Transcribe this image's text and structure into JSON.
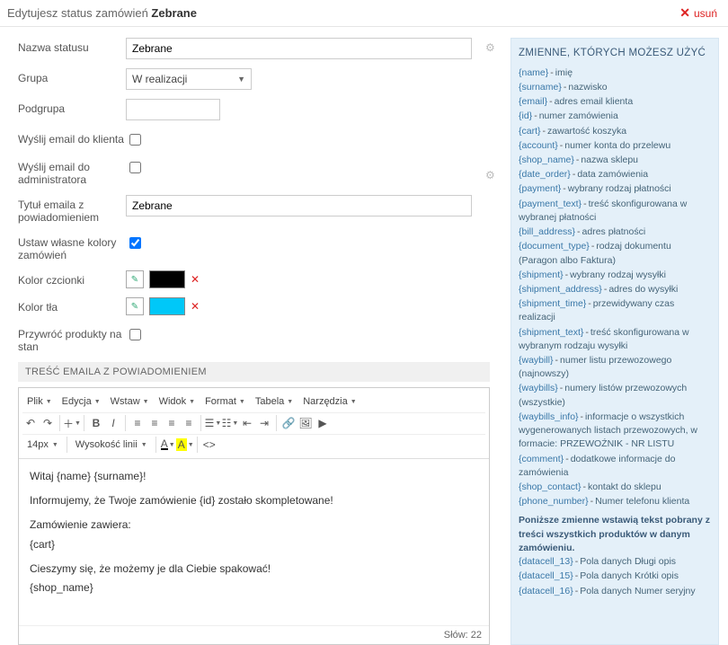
{
  "header": {
    "prefix": "Edytujesz status zamówień ",
    "name": "Zebrane",
    "delete": "usuń"
  },
  "form": {
    "name_label": "Nazwa statusu",
    "name_value": "Zebrane",
    "group_label": "Grupa",
    "group_value": "W realizacji",
    "subgroup_label": "Podgrupa",
    "email_client_label": "Wyślij email do klienta",
    "email_admin_label": "Wyślij email do administratora",
    "email_title_label": "Tytuł emaila z powiadomieniem",
    "email_title_value": "Zebrane",
    "custom_colors_label": "Ustaw własne kolory zamówień",
    "font_color_label": "Kolor czcionki",
    "font_color": "#000000",
    "bg_color_label": "Kolor tła",
    "bg_color": "#00c8f8",
    "restore_label": "Przywróć produkty na stan"
  },
  "section_title": "TREŚĆ EMAILA Z POWIADOMIENIEM",
  "toolbar": {
    "file": "Plik",
    "edit": "Edycja",
    "insert": "Wstaw",
    "view": "Widok",
    "format": "Format",
    "table": "Tabela",
    "tools": "Narzędzia",
    "fontsize": "14px",
    "lineheight": "Wysokość linii"
  },
  "editor": {
    "l1": "Witaj {name} {surname}!",
    "l2": "Informujemy, że Twoje zamówienie {id} zostało skompletowane!",
    "l3": "Zamówienie zawiera:",
    "l4": "{cart}",
    "l5": "Cieszymy się, że możemy je dla Ciebie spakować!",
    "l6": "{shop_name}",
    "words": "Słów: 22"
  },
  "vars": {
    "title": "ZMIENNE, KTÓRYCH MOŻESZ UŻYĆ",
    "items": [
      {
        "k": "{name}",
        "d": "imię"
      },
      {
        "k": "{surname}",
        "d": "nazwisko"
      },
      {
        "k": "{email}",
        "d": "adres email klienta"
      },
      {
        "k": "{id}",
        "d": "numer zamówienia"
      },
      {
        "k": "{cart}",
        "d": "zawartość koszyka"
      },
      {
        "k": "{account}",
        "d": "numer konta do przelewu"
      },
      {
        "k": "{shop_name}",
        "d": "nazwa sklepu"
      },
      {
        "k": "{date_order}",
        "d": "data zamówienia"
      },
      {
        "k": "{payment}",
        "d": "wybrany rodzaj płatności"
      },
      {
        "k": "{payment_text}",
        "d": "treść skonfigurowana w wybranej płatności"
      },
      {
        "k": "{bill_address}",
        "d": "adres płatności"
      },
      {
        "k": "{document_type}",
        "d": "rodzaj dokumentu (Paragon albo Faktura)"
      },
      {
        "k": "{shipment}",
        "d": "wybrany rodzaj wysyłki"
      },
      {
        "k": "{shipment_address}",
        "d": "adres do wysyłki"
      },
      {
        "k": "{shipment_time}",
        "d": "przewidywany czas realizacji"
      },
      {
        "k": "{shipment_text}",
        "d": "treść skonfigurowana w wybranym rodzaju wysyłki"
      },
      {
        "k": "{waybill}",
        "d": "numer listu przewozowego (najnowszy)"
      },
      {
        "k": "{waybills}",
        "d": "numery listów przewozowych (wszystkie)"
      },
      {
        "k": "{waybills_info}",
        "d": "informacje o wszystkich wygenerowanych listach przewozowych, w formacie:   PRZEWOŹNIK -   NR LISTU"
      },
      {
        "k": "{comment}",
        "d": "dodatkowe informacje do zamówienia"
      },
      {
        "k": "{shop_contact}",
        "d": "kontakt do sklepu"
      },
      {
        "k": "{phone_number}",
        "d": "Numer telefonu klienta"
      }
    ],
    "note": "Poniższe zmienne wstawią tekst pobrany z treści wszystkich produktów w danym zamówieniu.",
    "items2": [
      {
        "k": "{datacell_13}",
        "d": "Pola danych Długi opis"
      },
      {
        "k": "{datacell_15}",
        "d": "Pola danych Krótki opis"
      },
      {
        "k": "{datacell_16}",
        "d": "Pola danych Numer seryjny"
      }
    ]
  }
}
